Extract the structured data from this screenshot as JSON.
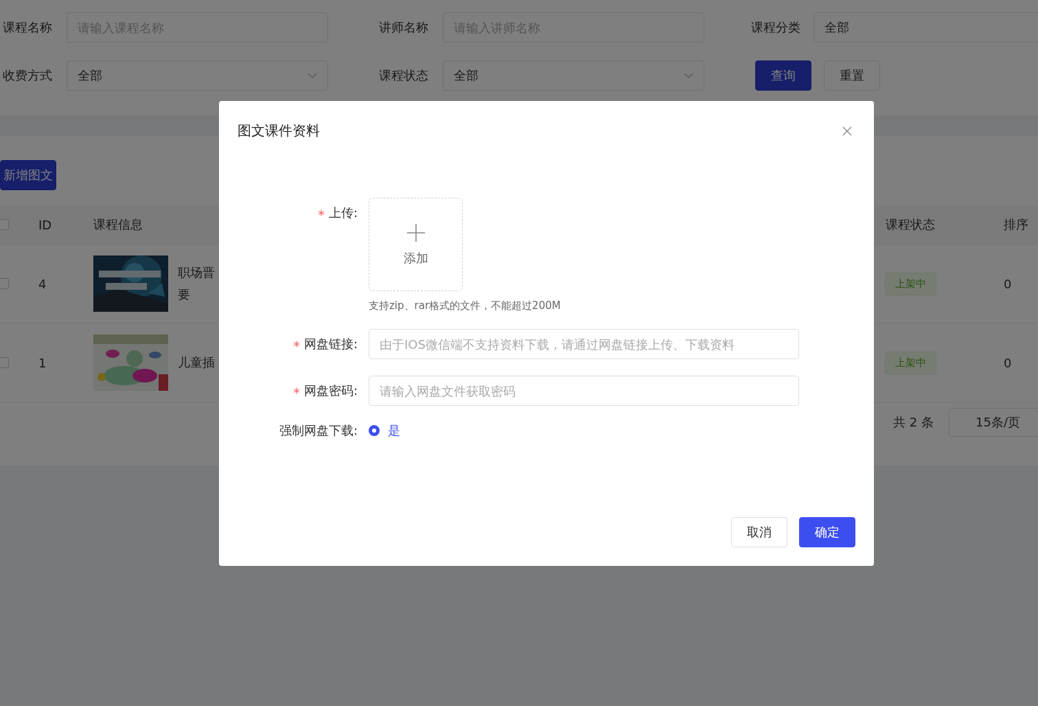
{
  "filters": [
    {
      "label": "课程名称",
      "kind": "input",
      "placeholder": "请输入课程名称"
    },
    {
      "label": "讲师名称",
      "kind": "input",
      "placeholder": "请输入讲师名称"
    },
    {
      "label": "课程分类",
      "kind": "select",
      "value": "全部",
      "cut": true
    },
    {
      "label": "收费方式",
      "kind": "select",
      "value": "全部"
    },
    {
      "label": "课程状态",
      "kind": "select",
      "value": "全部"
    }
  ],
  "filter_buttons": [
    {
      "label": "查询",
      "primary": true
    },
    {
      "label": "重置",
      "primary": false
    }
  ],
  "add_button": "新增图文",
  "table": {
    "all_checked": false,
    "columns": [
      "ID",
      "课程信息",
      "课程状态",
      "排序"
    ],
    "rows": [
      {
        "checked": false,
        "id": "4",
        "title_lines": [
          "职场晋",
          "要"
        ],
        "status": "上架中",
        "sort": "0",
        "kind": "picture"
      },
      {
        "checked": false,
        "id": "1",
        "title_lines": [
          "儿童插"
        ],
        "status": "上架中",
        "sort": "0",
        "kind": "picture"
      }
    ]
  },
  "pagination": {
    "total": "共 2 条",
    "page_size": "15条/页"
  },
  "dialog": {
    "title": "图文课件资料",
    "upload": {
      "label": "上传:",
      "required": true,
      "button": "添加",
      "hint": "支持zip、rar格式的文件，不能超过200M"
    },
    "fields": [
      {
        "label": "网盘链接:",
        "required": true,
        "placeholder": "由于IOS微信端不支持资料下载，请通过网盘链接上传、下载资料"
      },
      {
        "label": "网盘密码:",
        "required": true,
        "placeholder": "请输入网盘文件获取密码"
      }
    ],
    "radio": {
      "label": "强制网盘下载:",
      "required": false,
      "options": [
        {
          "label": "是",
          "selected": true
        }
      ]
    },
    "buttons": [
      {
        "label": "取消",
        "primary": false
      },
      {
        "label": "确定",
        "primary": true
      }
    ]
  }
}
